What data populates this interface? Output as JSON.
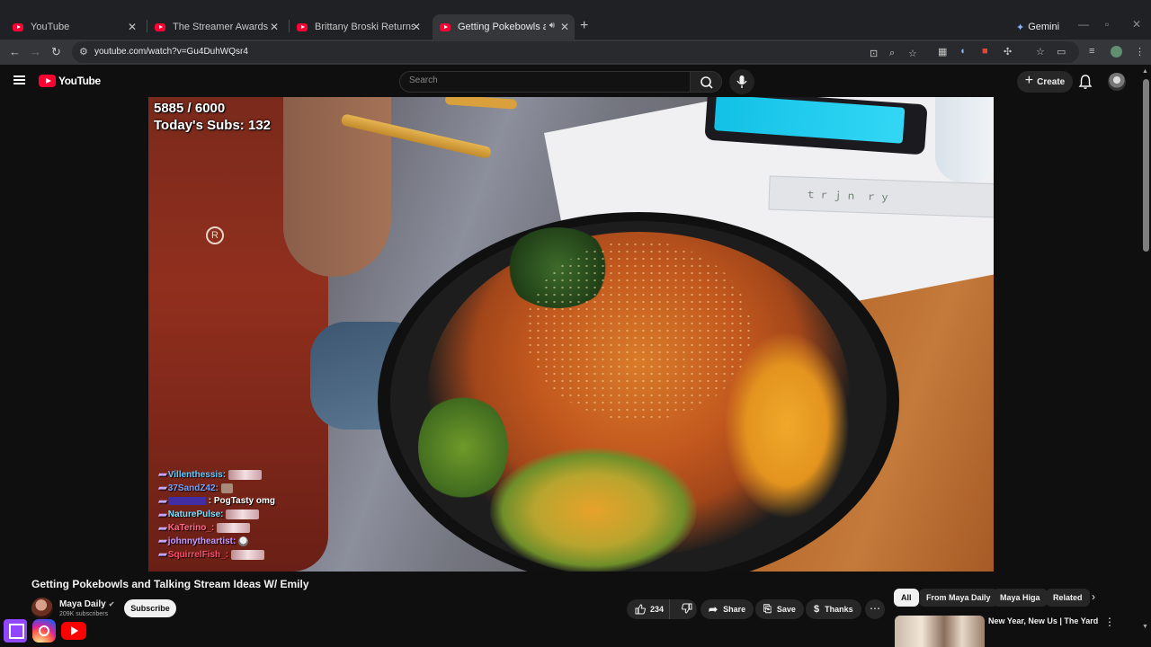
{
  "browser": {
    "tabs": [
      {
        "title": "YouTube",
        "active": false
      },
      {
        "title": "The Streamer Awards - YouTube",
        "active": false
      },
      {
        "title": "Brittany Broski Returns - YouTube",
        "active": false
      },
      {
        "title": "Getting Pokebowls and Talking",
        "active": true
      }
    ],
    "gemini_label": "Gemini",
    "url": "youtube.com/watch?v=Gu4DuhWQsr4"
  },
  "youtube": {
    "logo_text": "YouTube",
    "search_placeholder": "Search",
    "create_label": "Create"
  },
  "video": {
    "overlay": {
      "sub_goal": "5885 / 6000",
      "todays_subs": "Today's Subs: 132"
    },
    "chat": [
      {
        "user": "Villenthessis:",
        "color": "#62c9ff",
        "message": "",
        "emote": "wide"
      },
      {
        "user": "37SandZ42:",
        "color": "#6fa2ff",
        "message": "",
        "emote": "small"
      },
      {
        "user": "",
        "color": "#2233ff",
        "message": ": PogTasty omg",
        "emote": "none"
      },
      {
        "user": "NaturePulse:",
        "color": "#7fe0ff",
        "message": "",
        "emote": "wide"
      },
      {
        "user": "KaTerino_:",
        "color": "#ff6b8a",
        "message": "",
        "emote": "wide"
      },
      {
        "user": "johnnytheartist:",
        "color": "#c39bff",
        "message": "",
        "emote": "face"
      },
      {
        "user": "SquirrelFish_:",
        "color": "#ff4d6d",
        "message": "",
        "emote": "wide"
      }
    ]
  },
  "meta": {
    "title": "Getting Pokebowls and Talking Stream Ideas W/ Emily",
    "channel": "Maya Daily",
    "subscribers": "209K subscribers",
    "subscribe_label": "Subscribe",
    "likes": "234",
    "share_label": "Share",
    "save_label": "Save",
    "thanks_label": "Thanks"
  },
  "sidebar": {
    "chips": [
      "All",
      "From Maya Daily",
      "Maya Higa",
      "Related"
    ],
    "recommended_title": "New Year, New Us | The Yard"
  },
  "colors": {
    "youtube_red": "#ff0033",
    "background": "#0f0f0f",
    "twitch": "#9146ff"
  }
}
